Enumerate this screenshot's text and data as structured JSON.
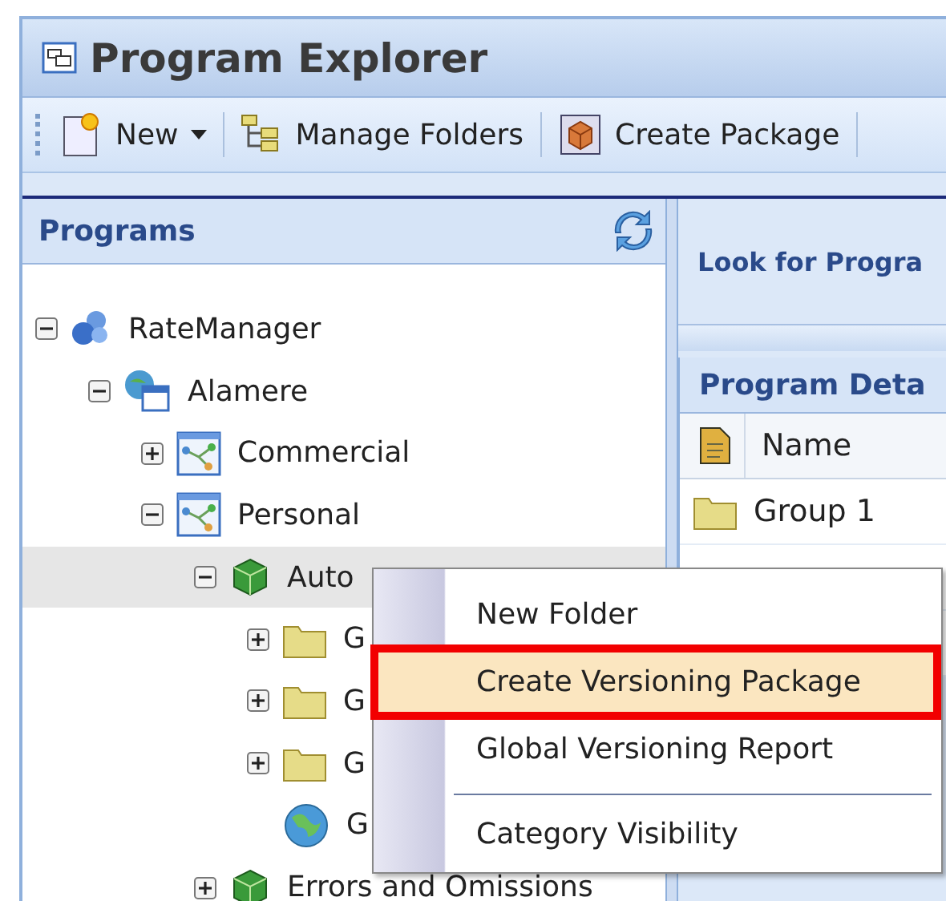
{
  "window": {
    "title": "Program Explorer"
  },
  "toolbar": [
    {
      "kind": "new",
      "label": "New",
      "dropdown": true
    },
    {
      "kind": "folders",
      "label": "Manage Folders",
      "dropdown": false
    },
    {
      "kind": "package",
      "label": "Create Package",
      "dropdown": false
    }
  ],
  "programs_panel": {
    "title": "Programs",
    "tree": [
      {
        "label": "RateManager",
        "kind": "database",
        "expanded": true,
        "selected": false,
        "children": [
          {
            "label": "Alamere",
            "kind": "site",
            "expanded": true,
            "selected": false,
            "children": [
              {
                "label": "Commercial",
                "kind": "flow",
                "expanded": false,
                "selected": false
              },
              {
                "label": "Personal",
                "kind": "flow",
                "expanded": true,
                "selected": false,
                "children": [
                  {
                    "label": "Auto",
                    "kind": "cube",
                    "expanded": true,
                    "selected": true,
                    "children": [
                      {
                        "label": "G",
                        "kind": "folder",
                        "expanded": false,
                        "selected": false
                      },
                      {
                        "label": "G",
                        "kind": "folder",
                        "expanded": false,
                        "selected": false
                      },
                      {
                        "label": "G",
                        "kind": "folder",
                        "expanded": false,
                        "selected": false
                      },
                      {
                        "label": "G",
                        "kind": "globe",
                        "selected": false
                      }
                    ]
                  },
                  {
                    "label": "Errors and Omissions",
                    "kind": "cube",
                    "expanded": false,
                    "selected": false
                  }
                ]
              }
            ]
          }
        ]
      }
    ]
  },
  "search_panel": {
    "label": "Look for Progra"
  },
  "details_panel": {
    "title": "Program Deta",
    "columns": [
      {
        "kind": "icon"
      },
      {
        "kind": "text",
        "label": "Name"
      }
    ],
    "rows": [
      {
        "kind": "folder",
        "name": "Group 1"
      }
    ]
  },
  "context_menu": [
    {
      "label": "New Folder",
      "selected": false,
      "outlined": false,
      "separator_before": false
    },
    {
      "label": "Create Versioning Package",
      "selected": true,
      "outlined": true,
      "separator_before": false
    },
    {
      "label": "Global Versioning Report",
      "selected": false,
      "outlined": false,
      "separator_before": false
    },
    {
      "label": "Category Visibility",
      "selected": false,
      "outlined": false,
      "separator_before": true
    }
  ]
}
